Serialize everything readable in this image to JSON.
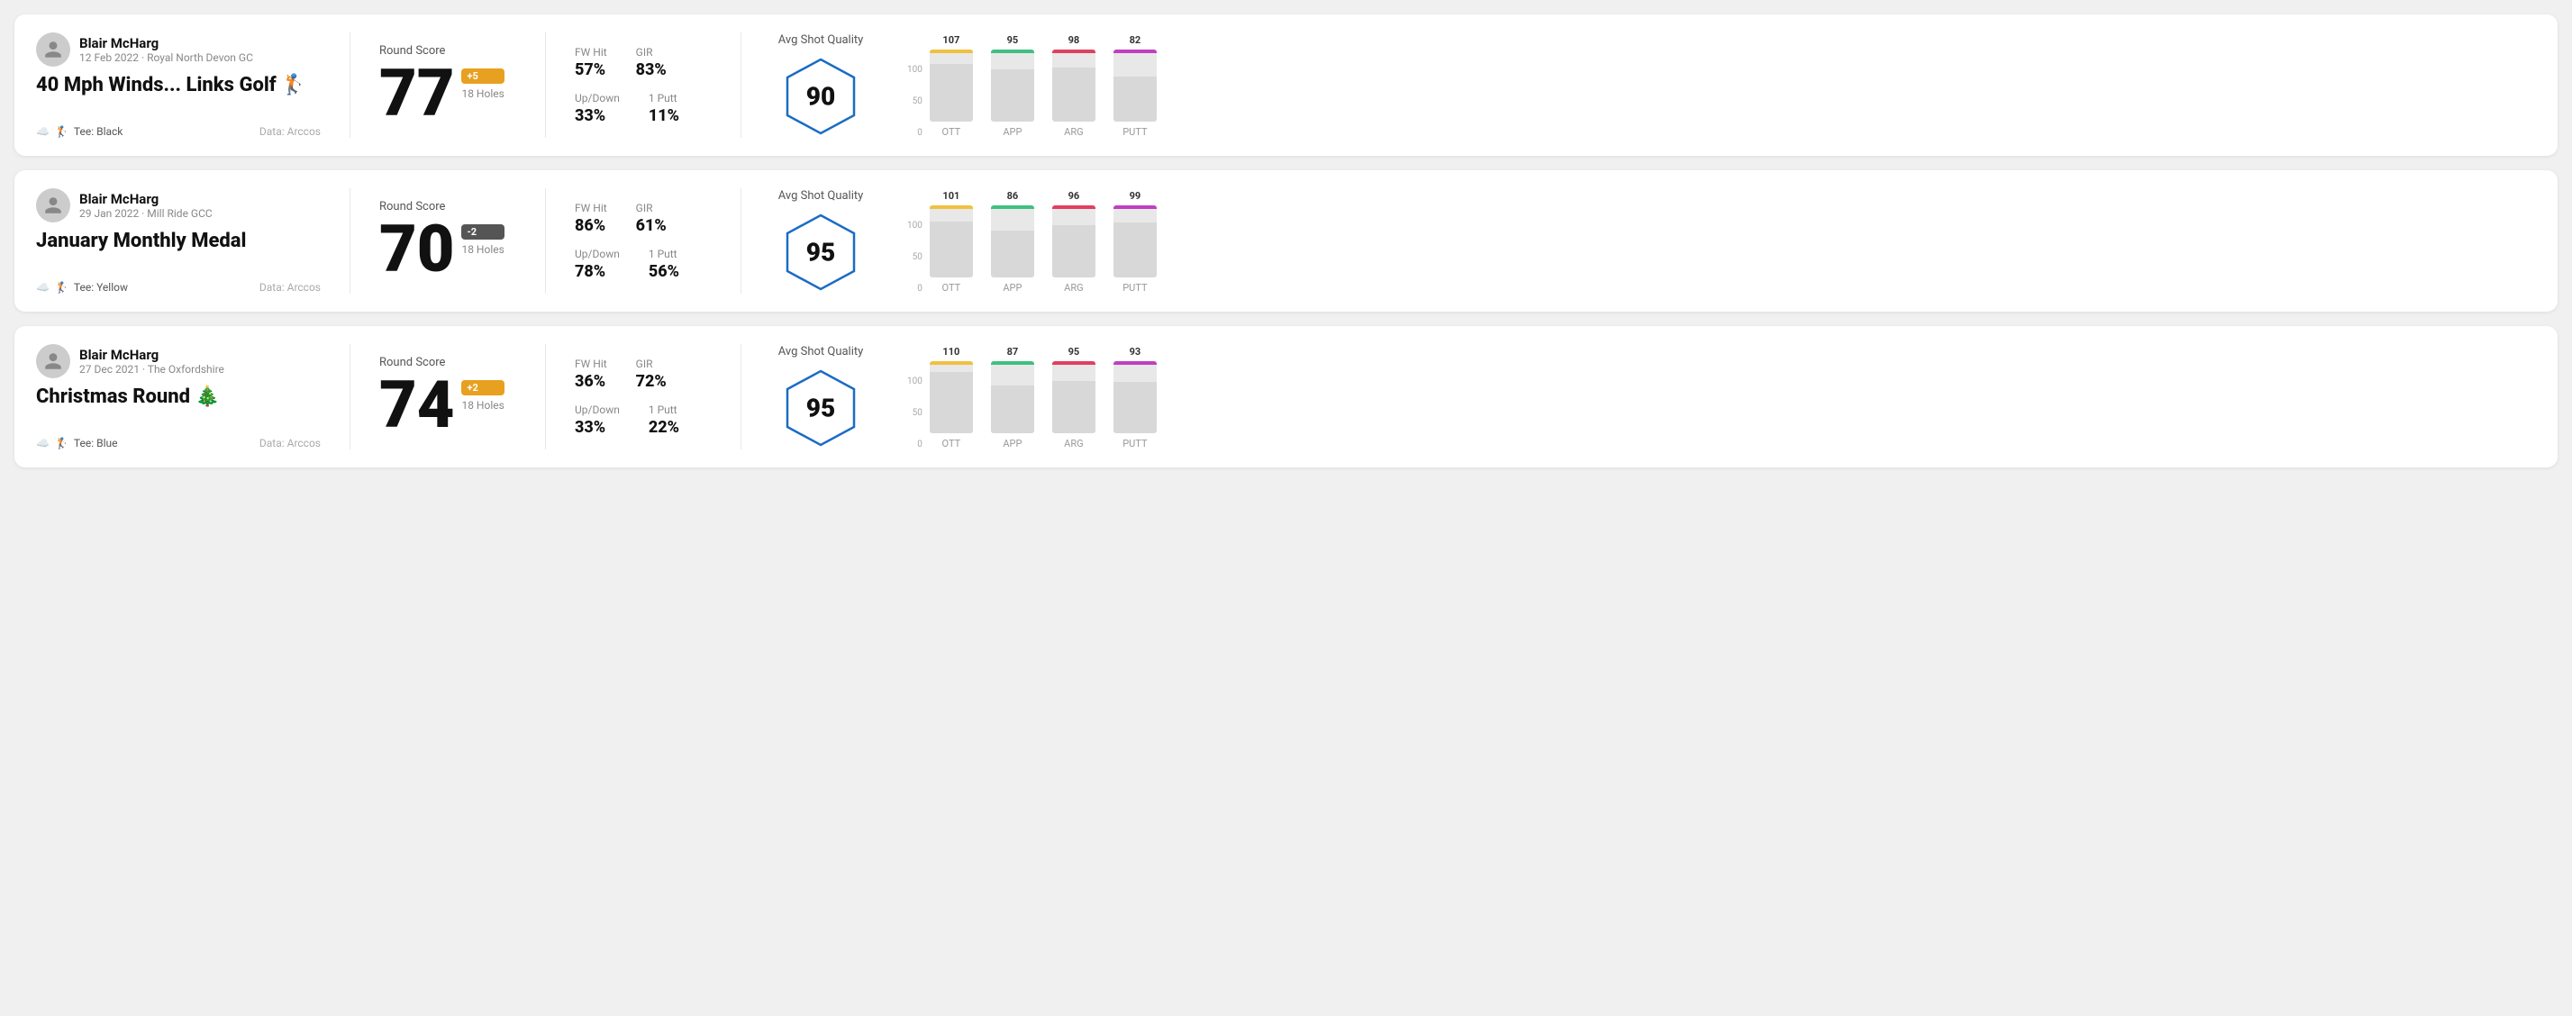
{
  "rounds": [
    {
      "id": "round1",
      "player": "Blair McHarg",
      "date": "12 Feb 2022",
      "course": "Royal North Devon GC",
      "title": "40 Mph Winds... Links Golf 🏌️",
      "tee": "Black",
      "data_source": "Data: Arccos",
      "score": "77",
      "score_diff": "+5",
      "score_diff_type": "positive",
      "holes": "18 Holes",
      "fw_hit": "57%",
      "gir": "83%",
      "up_down": "33%",
      "one_putt": "11%",
      "avg_shot_quality": "90",
      "chart_bars": [
        {
          "label": "OTT",
          "value": 107,
          "color": "#f0c040",
          "pct": 80
        },
        {
          "label": "APP",
          "value": 95,
          "color": "#40c080",
          "pct": 72
        },
        {
          "label": "ARG",
          "value": 98,
          "color": "#e04060",
          "pct": 75
        },
        {
          "label": "PUTT",
          "value": 82,
          "color": "#c040c0",
          "pct": 62
        }
      ]
    },
    {
      "id": "round2",
      "player": "Blair McHarg",
      "date": "29 Jan 2022",
      "course": "Mill Ride GCC",
      "title": "January Monthly Medal",
      "tee": "Yellow",
      "data_source": "Data: Arccos",
      "score": "70",
      "score_diff": "-2",
      "score_diff_type": "negative",
      "holes": "18 Holes",
      "fw_hit": "86%",
      "gir": "61%",
      "up_down": "78%",
      "one_putt": "56%",
      "avg_shot_quality": "95",
      "chart_bars": [
        {
          "label": "OTT",
          "value": 101,
          "color": "#f0c040",
          "pct": 78
        },
        {
          "label": "APP",
          "value": 86,
          "color": "#40c080",
          "pct": 65
        },
        {
          "label": "ARG",
          "value": 96,
          "color": "#e04060",
          "pct": 73
        },
        {
          "label": "PUTT",
          "value": 99,
          "color": "#c040c0",
          "pct": 76
        }
      ]
    },
    {
      "id": "round3",
      "player": "Blair McHarg",
      "date": "27 Dec 2021",
      "course": "The Oxfordshire",
      "title": "Christmas Round 🎄",
      "tee": "Blue",
      "data_source": "Data: Arccos",
      "score": "74",
      "score_diff": "+2",
      "score_diff_type": "positive",
      "holes": "18 Holes",
      "fw_hit": "36%",
      "gir": "72%",
      "up_down": "33%",
      "one_putt": "22%",
      "avg_shot_quality": "95",
      "chart_bars": [
        {
          "label": "OTT",
          "value": 110,
          "color": "#f0c040",
          "pct": 85
        },
        {
          "label": "APP",
          "value": 87,
          "color": "#40c080",
          "pct": 66
        },
        {
          "label": "ARG",
          "value": 95,
          "color": "#e04060",
          "pct": 72
        },
        {
          "label": "PUTT",
          "value": 93,
          "color": "#c040c0",
          "pct": 71
        }
      ]
    }
  ],
  "ui": {
    "round_score_label": "Round Score",
    "fw_hit_label": "FW Hit",
    "gir_label": "GIR",
    "up_down_label": "Up/Down",
    "one_putt_label": "1 Putt",
    "avg_shot_quality_label": "Avg Shot Quality",
    "y_axis": [
      "100",
      "50",
      "0"
    ]
  }
}
